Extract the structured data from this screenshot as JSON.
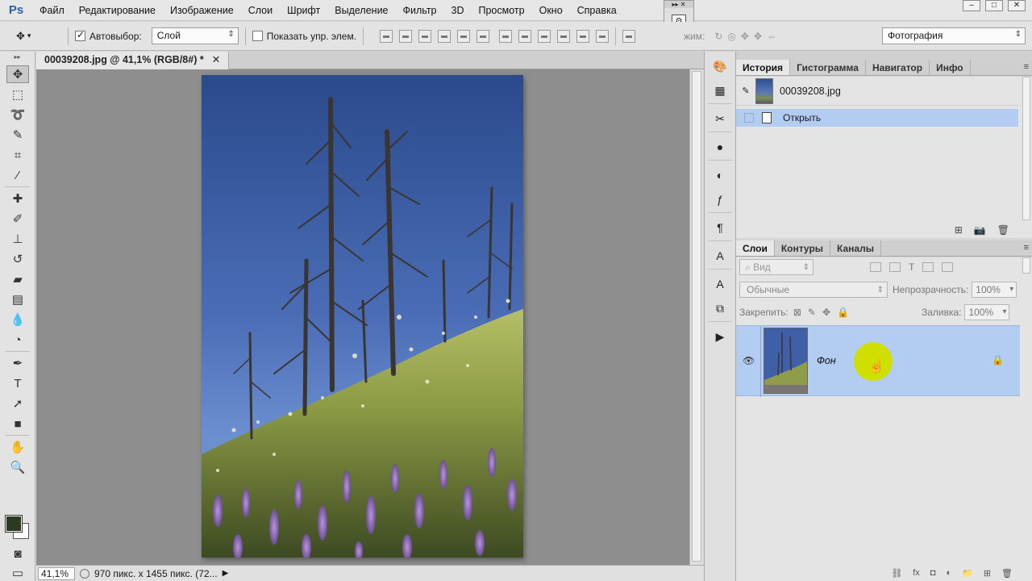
{
  "app": {
    "logo": "Ps"
  },
  "menu": [
    "Файл",
    "Редактирование",
    "Изображение",
    "Слои",
    "Шрифт",
    "Выделение",
    "Фильтр",
    "3D",
    "Просмотр",
    "Окно",
    "Справка"
  ],
  "window_controls": {
    "minimize": "–",
    "maximize": "□",
    "close": "✕"
  },
  "options": {
    "autoselect_label": "Автовыбор:",
    "autoselect_checked": true,
    "autoselect_value": "Слой",
    "show_transform_label": "Показать упр. элем.",
    "show_transform_checked": false,
    "mode_label": "жим:",
    "workspace": "Фотография"
  },
  "document": {
    "tab_title": "00039208.jpg @ 41,1% (RGB/8#) *",
    "close": "✕"
  },
  "status": {
    "zoom": "41,1%",
    "info": "970 пикс. x 1455 пикс. (72..."
  },
  "history_panel": {
    "tabs": [
      "История",
      "Гистограмма",
      "Навигатор",
      "Инфо"
    ],
    "snapshot_name": "00039208.jpg",
    "step_name": "Открыть"
  },
  "layers_panel": {
    "tabs": [
      "Слои",
      "Контуры",
      "Каналы"
    ],
    "filter_placeholder": "Вид",
    "blend_mode": "Обычные",
    "opacity_label": "Непрозрачность:",
    "opacity_value": "100%",
    "lock_label": "Закрепить:",
    "fill_label": "Заливка:",
    "fill_value": "100%",
    "layer_name": "Фон"
  },
  "colors": {
    "foreground": "#2b3a1f",
    "background": "#ffffff",
    "selection": "#b3ccf2",
    "cursor_highlight": "#cfe000"
  }
}
